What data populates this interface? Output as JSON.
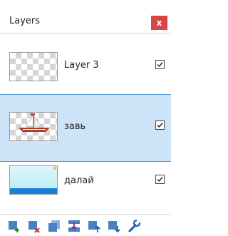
{
  "panel": {
    "title": "Layers",
    "close_label": "x"
  },
  "layers": [
    {
      "name": "Layer 3",
      "visible": true,
      "selected": false,
      "thumbnail": "transparent-checker"
    },
    {
      "name": "завь",
      "visible": true,
      "selected": true,
      "thumbnail": "boat-on-checker"
    },
    {
      "name": "далай",
      "visible": true,
      "selected": false,
      "thumbnail": "sea-gradient"
    }
  ],
  "toolbar": {
    "buttons": [
      {
        "icon": "add-layer-icon"
      },
      {
        "icon": "delete-layer-icon"
      },
      {
        "icon": "duplicate-layer-icon"
      },
      {
        "icon": "merge-layer-down-icon"
      },
      {
        "icon": "move-layer-up-icon"
      },
      {
        "icon": "move-layer-down-icon"
      },
      {
        "icon": "layer-properties-icon"
      }
    ]
  },
  "colors": {
    "selected_bg": "#cde3f7",
    "selected_border": "#5b9bd5",
    "close_bg": "#d94444",
    "icon_blue": "#4a7fc1"
  }
}
